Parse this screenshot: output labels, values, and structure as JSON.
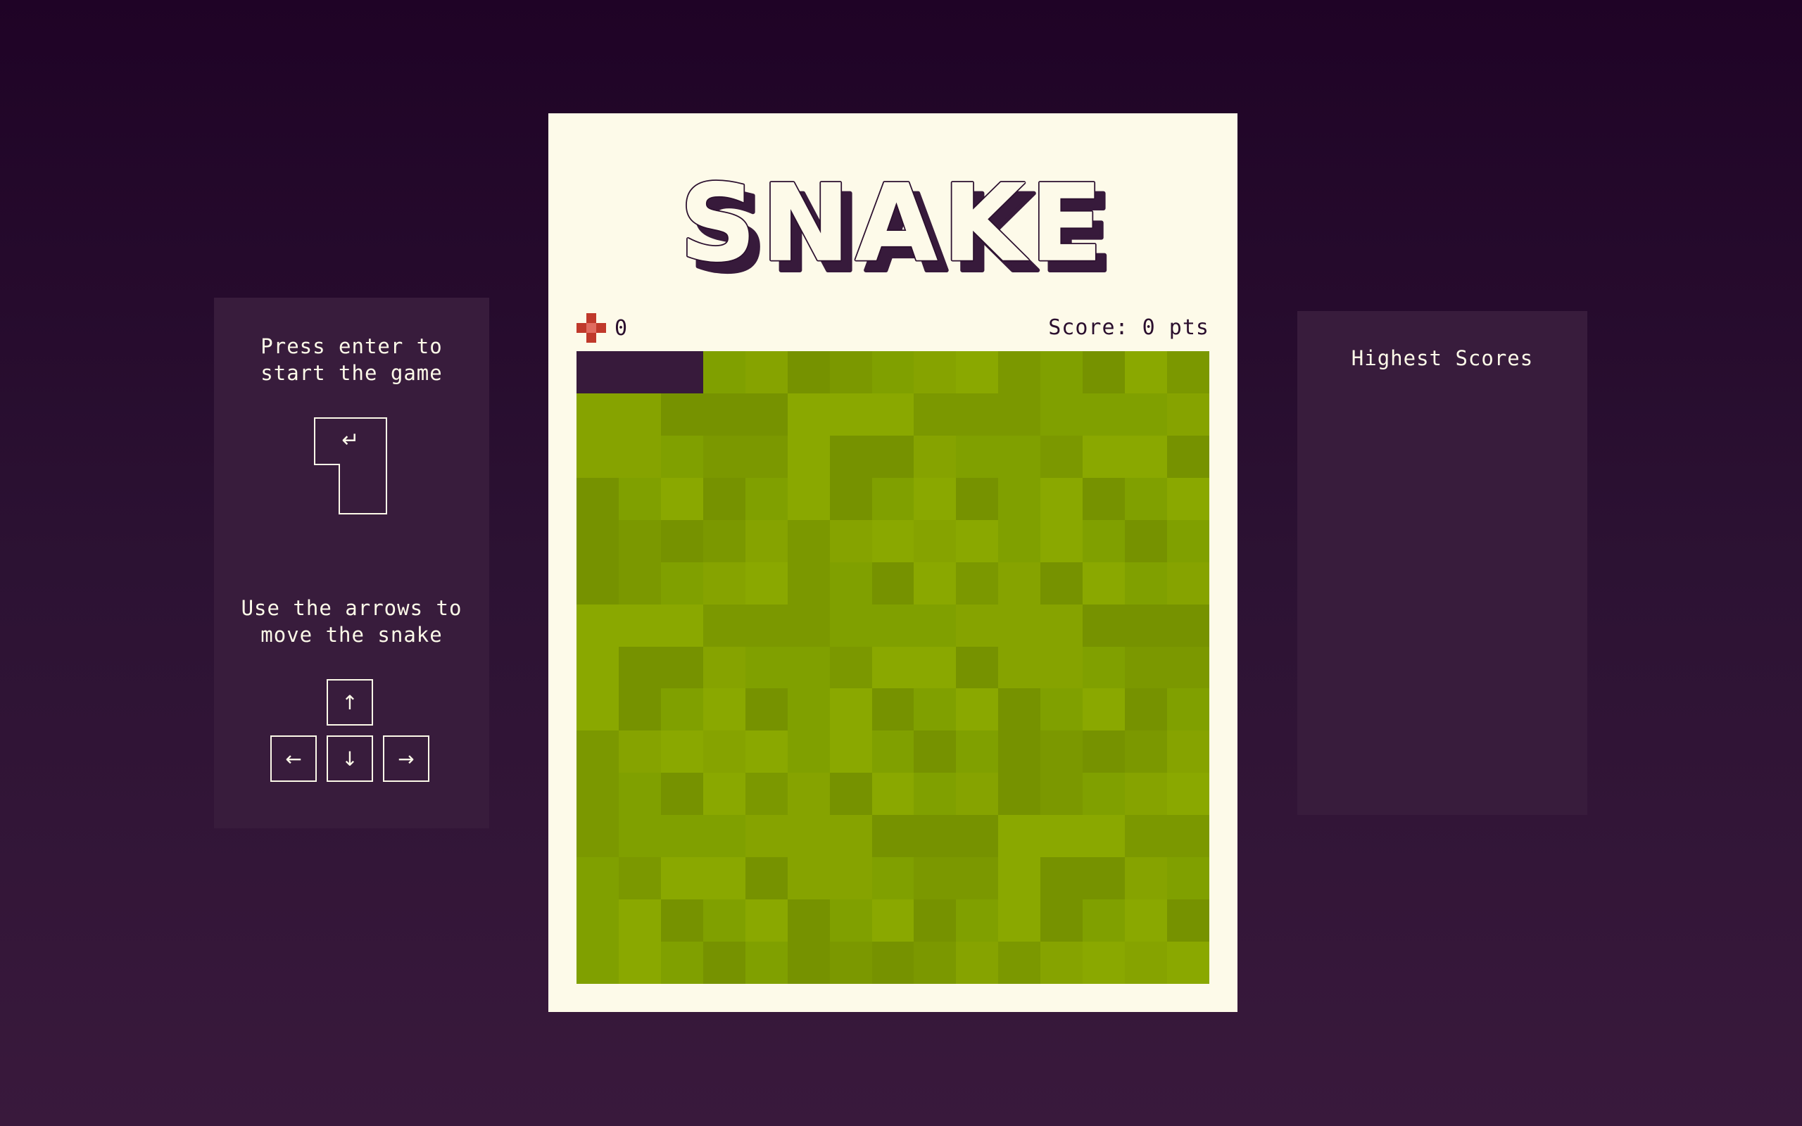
{
  "instructions": {
    "enter_text": "Press enter to\nstart the game",
    "enter_key_symbol": "↵",
    "arrows_text": "Use the arrows to\nmove the snake",
    "arrow_up": "↑",
    "arrow_left": "←",
    "arrow_down": "↓",
    "arrow_right": "→"
  },
  "game": {
    "title": "SNAKE",
    "food_eaten": "0",
    "score_text": "Score: 0 pts",
    "grid_columns": 15,
    "grid_rows": 15,
    "snake": [
      [
        0,
        0
      ],
      [
        1,
        0
      ],
      [
        2,
        0
      ]
    ]
  },
  "highscores": {
    "title": "Highest Scores",
    "entries": []
  },
  "colors": {
    "background_top": "#1f0326",
    "background_bottom": "#39193c",
    "panel": "#381c3c",
    "card": "#fdfae9",
    "snake": "#371a3b",
    "food": "#c0392b",
    "board_greens": [
      "#86a300",
      "#80a000",
      "#7b9800",
      "#8aa800",
      "#769200"
    ]
  }
}
